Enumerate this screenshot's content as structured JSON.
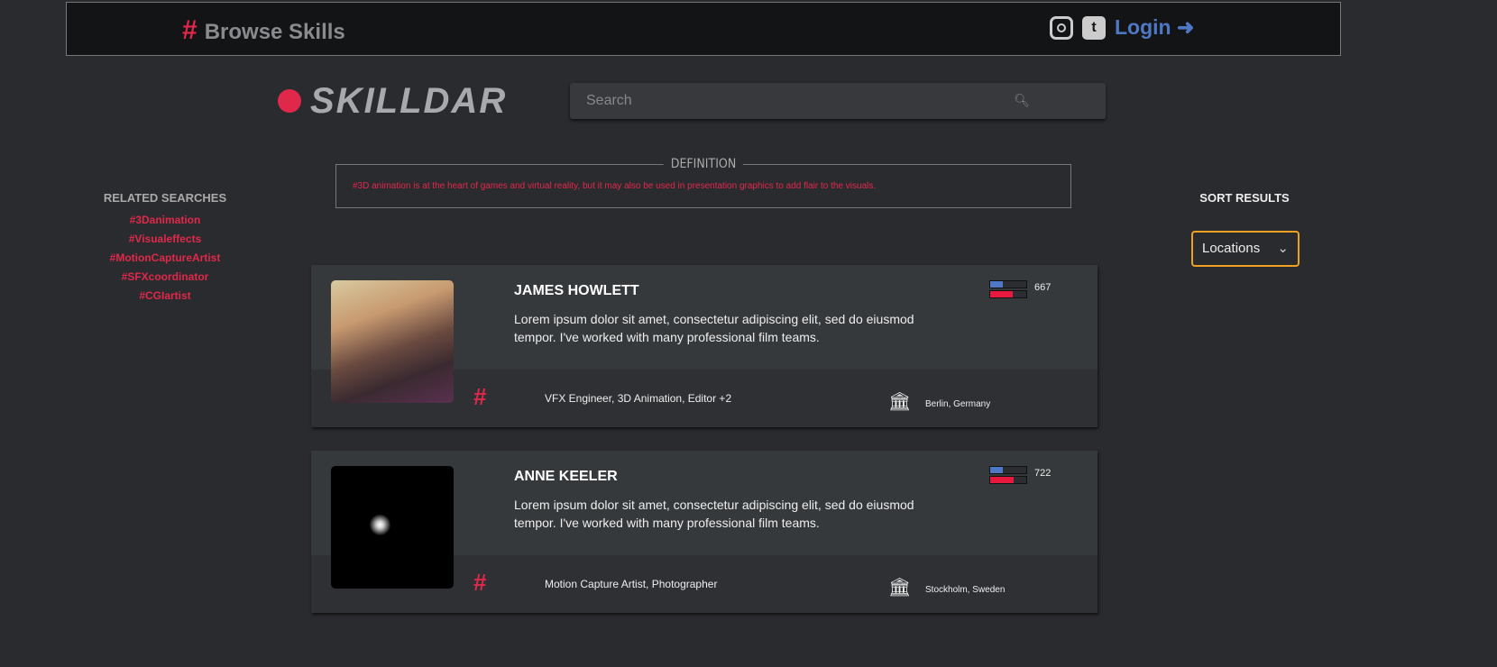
{
  "nav": {
    "browse_label": "Browse Skills",
    "login_label": "Login"
  },
  "brand": {
    "name": "SKILLDAR"
  },
  "search": {
    "placeholder": "Search"
  },
  "definition": {
    "label": "DEFINITION",
    "text": "#3D animation is at the heart of games and virtual reality, but it may also be used in presentation graphics to add flair to the visuals."
  },
  "related": {
    "title": "RELATED SEARCHES",
    "items": [
      "#3Danimation",
      "#Visualeffects",
      "#MotionCaptureArtist",
      "#SFXcoordinator",
      "#CGIartist"
    ]
  },
  "sort": {
    "title": "SORT RESULTS",
    "selected": "Locations"
  },
  "results": [
    {
      "name": "JAMES HOWLETT",
      "description": "Lorem ipsum dolor sit amet, consectetur adipiscing elit, sed do eiusmod tempor. I've worked with many professional film teams.",
      "score": "667",
      "blue_fill": 0.35,
      "red_fill": 0.62,
      "skills": "VFX Engineer, 3D Animation, Editor +2",
      "location": "Berlin, Germany"
    },
    {
      "name": "ANNE KEELER",
      "description": "Lorem ipsum dolor sit amet, consectetur adipiscing elit, sed do eiusmod tempor. I've worked with many professional film teams.",
      "score": "722",
      "blue_fill": 0.35,
      "red_fill": 0.65,
      "skills": "Motion Capture Artist, Photographer",
      "location": "Stockholm, Sweden"
    }
  ],
  "colors": {
    "accent": "#e0284a",
    "blue": "#4f78c4",
    "highlight": "#f0a020"
  }
}
